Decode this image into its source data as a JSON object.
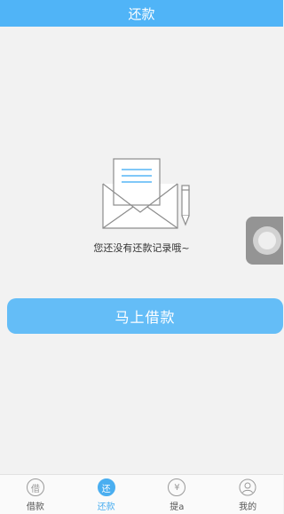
{
  "header": {
    "title": "还款"
  },
  "empty_state": {
    "message": "您还没有还款记录哦~"
  },
  "cta": {
    "label": "马上借款"
  },
  "tabbar": {
    "items": [
      {
        "icon_text": "借",
        "label": "借款",
        "icon": "borrow-icon",
        "active": false
      },
      {
        "icon_text": "还",
        "label": "还款",
        "icon": "repay-icon",
        "active": true
      },
      {
        "icon_text": "¥",
        "label": "提a",
        "icon": "yen-icon",
        "active": false
      },
      {
        "icon_text": "",
        "label": "我的",
        "icon": "profile-icon",
        "active": false
      }
    ]
  },
  "colors": {
    "accent": "#50b4f7",
    "button": "#64bdf7",
    "background": "#f2f2f2"
  }
}
